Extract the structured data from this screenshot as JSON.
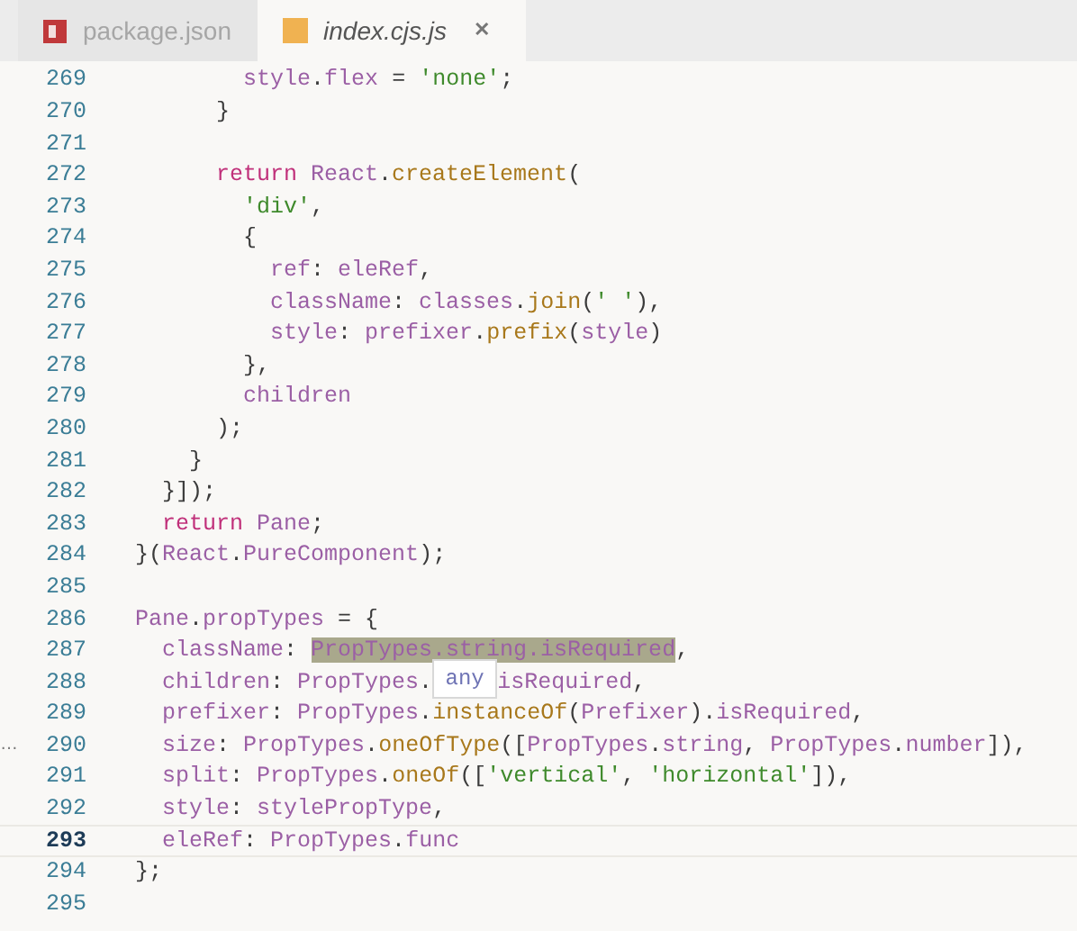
{
  "tabs": [
    {
      "label": "package.json",
      "kind": "npm",
      "selected": false
    },
    {
      "label": "index.cjs.js",
      "kind": "js",
      "selected": true,
      "close": "✕"
    }
  ],
  "lines": [
    {
      "number": "269",
      "kind": "normal",
      "code": [
        {
          "kind": "id",
          "text": "        style"
        },
        {
          "kind": "pn",
          "text": "."
        },
        {
          "kind": "id",
          "text": "flex"
        },
        {
          "kind": "pn",
          "text": " = "
        },
        {
          "kind": "str",
          "text": "'none'"
        },
        {
          "kind": "pn",
          "text": ";"
        }
      ]
    },
    {
      "number": "270",
      "kind": "normal",
      "code": [
        {
          "kind": "pn",
          "text": "      }"
        }
      ]
    },
    {
      "number": "271",
      "kind": "normal"
    },
    {
      "number": "272",
      "kind": "normal",
      "code": [
        {
          "kind": "kw",
          "text": "      return"
        },
        {
          "kind": "id",
          "text": " React"
        },
        {
          "kind": "pn",
          "text": "."
        },
        {
          "kind": "fn",
          "text": "createElement"
        },
        {
          "kind": "pn",
          "text": "("
        }
      ]
    },
    {
      "number": "273",
      "kind": "normal",
      "code": [
        {
          "kind": "str",
          "text": "        'div'"
        },
        {
          "kind": "pn",
          "text": ","
        }
      ]
    },
    {
      "number": "274",
      "kind": "normal",
      "code": [
        {
          "kind": "pn",
          "text": "        {"
        }
      ]
    },
    {
      "number": "275",
      "kind": "normal",
      "code": [
        {
          "kind": "id",
          "text": "          ref"
        },
        {
          "kind": "pn",
          "text": ": "
        },
        {
          "kind": "id",
          "text": "eleRef"
        },
        {
          "kind": "pn",
          "text": ","
        }
      ]
    },
    {
      "number": "276",
      "kind": "normal",
      "code": [
        {
          "kind": "id",
          "text": "          className"
        },
        {
          "kind": "pn",
          "text": ": "
        },
        {
          "kind": "id",
          "text": "classes"
        },
        {
          "kind": "pn",
          "text": "."
        },
        {
          "kind": "fn",
          "text": "join"
        },
        {
          "kind": "pn",
          "text": "("
        },
        {
          "kind": "str",
          "text": "' '"
        },
        {
          "kind": "pn",
          "text": "),"
        }
      ]
    },
    {
      "number": "277",
      "kind": "normal",
      "code": [
        {
          "kind": "id",
          "text": "          style"
        },
        {
          "kind": "pn",
          "text": ": "
        },
        {
          "kind": "id",
          "text": "prefixer"
        },
        {
          "kind": "pn",
          "text": "."
        },
        {
          "kind": "fn",
          "text": "prefix"
        },
        {
          "kind": "pn",
          "text": "("
        },
        {
          "kind": "id",
          "text": "style"
        },
        {
          "kind": "pn",
          "text": ")"
        }
      ]
    },
    {
      "number": "278",
      "kind": "normal",
      "code": [
        {
          "kind": "pn",
          "text": "        },"
        }
      ]
    },
    {
      "number": "279",
      "kind": "normal",
      "code": [
        {
          "kind": "id",
          "text": "        children"
        }
      ]
    },
    {
      "number": "280",
      "kind": "normal",
      "code": [
        {
          "kind": "pn",
          "text": "      );"
        }
      ]
    },
    {
      "number": "281",
      "kind": "normal",
      "code": [
        {
          "kind": "pn",
          "text": "    }"
        }
      ]
    },
    {
      "number": "282",
      "kind": "normal",
      "code": [
        {
          "kind": "pn",
          "text": "  }]);"
        }
      ]
    },
    {
      "number": "283",
      "kind": "normal",
      "code": [
        {
          "kind": "kw",
          "text": "  return"
        },
        {
          "kind": "id",
          "text": " Pane"
        },
        {
          "kind": "pn",
          "text": ";"
        }
      ]
    },
    {
      "number": "284",
      "kind": "normal",
      "code": [
        {
          "kind": "pn",
          "text": "}("
        },
        {
          "kind": "id",
          "text": "React"
        },
        {
          "kind": "pn",
          "text": "."
        },
        {
          "kind": "id",
          "text": "PureComponent"
        },
        {
          "kind": "pn",
          "text": ");"
        }
      ]
    },
    {
      "number": "285",
      "kind": "normal"
    },
    {
      "number": "286",
      "kind": "normal",
      "code": [
        {
          "kind": "id",
          "text": "Pane"
        },
        {
          "kind": "pn",
          "text": "."
        },
        {
          "kind": "id",
          "text": "propTypes"
        },
        {
          "kind": "pn",
          "text": " = {"
        }
      ]
    },
    {
      "number": "287",
      "kind": "normal",
      "code": [
        {
          "kind": "id",
          "text": "  className"
        },
        {
          "kind": "pn",
          "text": ": "
        },
        {
          "kind": "match",
          "text": "PropTypes.string.isRequired"
        },
        {
          "kind": "pn",
          "text": ","
        }
      ]
    },
    {
      "number": "288",
      "kind": "normal",
      "code": [
        {
          "kind": "id",
          "text": "  children"
        },
        {
          "kind": "pn",
          "text": ": "
        },
        {
          "kind": "id",
          "text": "PropTypes"
        },
        {
          "kind": "pn",
          "text": "."
        },
        {
          "kind": "tooltip",
          "text": "any"
        },
        {
          "kind": "id",
          "text": "isRequired"
        },
        {
          "kind": "pn",
          "text": ","
        }
      ]
    },
    {
      "number": "289",
      "kind": "normal",
      "code": [
        {
          "kind": "id",
          "text": "  prefixer"
        },
        {
          "kind": "pn",
          "text": ": "
        },
        {
          "kind": "id",
          "text": "PropTypes"
        },
        {
          "kind": "pn",
          "text": "."
        },
        {
          "kind": "fn",
          "text": "instanceOf"
        },
        {
          "kind": "pn",
          "text": "("
        },
        {
          "kind": "id",
          "text": "Prefixer"
        },
        {
          "kind": "pn",
          "text": ")."
        },
        {
          "kind": "id",
          "text": "isRequired"
        },
        {
          "kind": "pn",
          "text": ","
        }
      ]
    },
    {
      "number": "290",
      "kind": "normal",
      "marker": "…",
      "code": [
        {
          "kind": "id",
          "text": "  size"
        },
        {
          "kind": "pn",
          "text": ": "
        },
        {
          "kind": "id",
          "text": "PropTypes"
        },
        {
          "kind": "pn",
          "text": "."
        },
        {
          "kind": "fn",
          "text": "oneOfType"
        },
        {
          "kind": "pn",
          "text": "(["
        },
        {
          "kind": "id",
          "text": "PropTypes"
        },
        {
          "kind": "pn",
          "text": "."
        },
        {
          "kind": "id",
          "text": "string"
        },
        {
          "kind": "pn",
          "text": ", "
        },
        {
          "kind": "id",
          "text": "PropTypes"
        },
        {
          "kind": "pn",
          "text": "."
        },
        {
          "kind": "id",
          "text": "number"
        },
        {
          "kind": "pn",
          "text": "]),"
        }
      ]
    },
    {
      "number": "291",
      "kind": "normal",
      "code": [
        {
          "kind": "id",
          "text": "  split"
        },
        {
          "kind": "pn",
          "text": ": "
        },
        {
          "kind": "id",
          "text": "PropTypes"
        },
        {
          "kind": "pn",
          "text": "."
        },
        {
          "kind": "fn",
          "text": "oneOf"
        },
        {
          "kind": "pn",
          "text": "(["
        },
        {
          "kind": "str",
          "text": "'vertical'"
        },
        {
          "kind": "pn",
          "text": ", "
        },
        {
          "kind": "str",
          "text": "'horizontal'"
        },
        {
          "kind": "pn",
          "text": "]),"
        }
      ]
    },
    {
      "number": "292",
      "kind": "normal",
      "code": [
        {
          "kind": "id",
          "text": "  style"
        },
        {
          "kind": "pn",
          "text": ": "
        },
        {
          "kind": "id",
          "text": "stylePropType"
        },
        {
          "kind": "pn",
          "text": ","
        }
      ]
    },
    {
      "number": "293",
      "kind": "current",
      "code": [
        {
          "kind": "id",
          "text": "  eleRef"
        },
        {
          "kind": "pn",
          "text": ": "
        },
        {
          "kind": "id",
          "text": "PropTypes"
        },
        {
          "kind": "pn",
          "text": "."
        },
        {
          "kind": "id",
          "text": "func"
        }
      ]
    },
    {
      "number": "294",
      "kind": "normal",
      "code": [
        {
          "kind": "pn",
          "text": "};"
        }
      ]
    },
    {
      "number": "295",
      "kind": "normal"
    }
  ]
}
